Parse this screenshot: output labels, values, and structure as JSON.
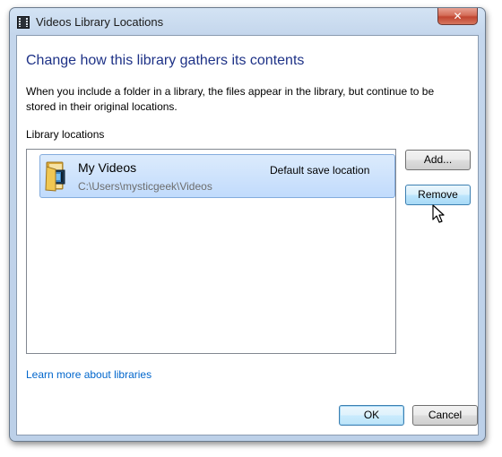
{
  "window": {
    "title": "Videos Library Locations",
    "close_glyph": "✕"
  },
  "heading": "Change how this library gathers its contents",
  "description": "When you include a folder in a library, the files appear in the library, but continue to be stored in their original locations.",
  "locations": {
    "label": "Library locations",
    "items": [
      {
        "name": "My Videos",
        "path": "C:\\Users\\mysticgeek\\Videos",
        "status": "Default save location",
        "icon": "videos-folder-icon"
      }
    ]
  },
  "buttons": {
    "add": "Add...",
    "remove": "Remove",
    "ok": "OK",
    "cancel": "Cancel"
  },
  "link": "Learn more about libraries",
  "colors": {
    "heading": "#1e3287",
    "link": "#0066cc",
    "selection": "#c1dbfc",
    "close_button": "#c14530"
  }
}
